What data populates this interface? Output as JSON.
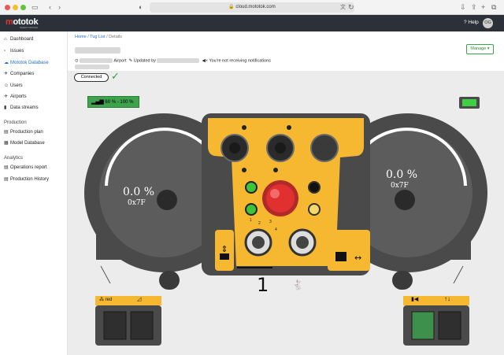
{
  "browser": {
    "url": "cloud.mototok.com"
  },
  "app": {
    "logo": "mototok",
    "logo_sub": "SMART MOVING",
    "help_label": "Help",
    "avatar_initials": "OG"
  },
  "sidebar": {
    "items": [
      {
        "label": "Dashboard",
        "icon": "dashboard-icon"
      },
      {
        "label": "Issues",
        "icon": "issues-icon"
      },
      {
        "label": "Mototok Database",
        "icon": "cloud-icon"
      },
      {
        "label": "Companies",
        "icon": "companies-icon"
      },
      {
        "label": "Users",
        "icon": "users-icon"
      },
      {
        "label": "Airports",
        "icon": "plane-icon"
      },
      {
        "label": "Data streams",
        "icon": "chart-icon"
      }
    ],
    "section_production": "Production",
    "production_items": [
      {
        "label": "Production plan",
        "icon": "plan-icon"
      },
      {
        "label": "Model Database",
        "icon": "database-icon"
      }
    ],
    "section_analytics": "Analytics",
    "analytics_items": [
      {
        "label": "Operations report",
        "icon": "report-icon"
      },
      {
        "label": "Production History",
        "icon": "history-icon"
      }
    ]
  },
  "header": {
    "breadcrumb_home": "Home",
    "breadcrumb_list": "Tug List",
    "breadcrumb_current": "Details",
    "separator": "/",
    "airport_label": "Airport",
    "updated_by": "Updated by",
    "notifications": "You're not receiving notifications",
    "manage_label": "Manage"
  },
  "status": {
    "connected_label": "Connected"
  },
  "panel": {
    "signal_label": "60 % - 100 %",
    "left_gauge_value": "0.0 %",
    "left_gauge_code": "0x7F",
    "right_gauge_value": "0.0 %",
    "right_gauge_code": "0x7F",
    "gear_number": "1",
    "speed_ticks": [
      "1",
      "2",
      "3",
      "4"
    ],
    "left_toggle_label": "red",
    "right_box_green_active": true,
    "accent_yellow": "#f5b830",
    "housing_gray": "#4a4a4a"
  }
}
